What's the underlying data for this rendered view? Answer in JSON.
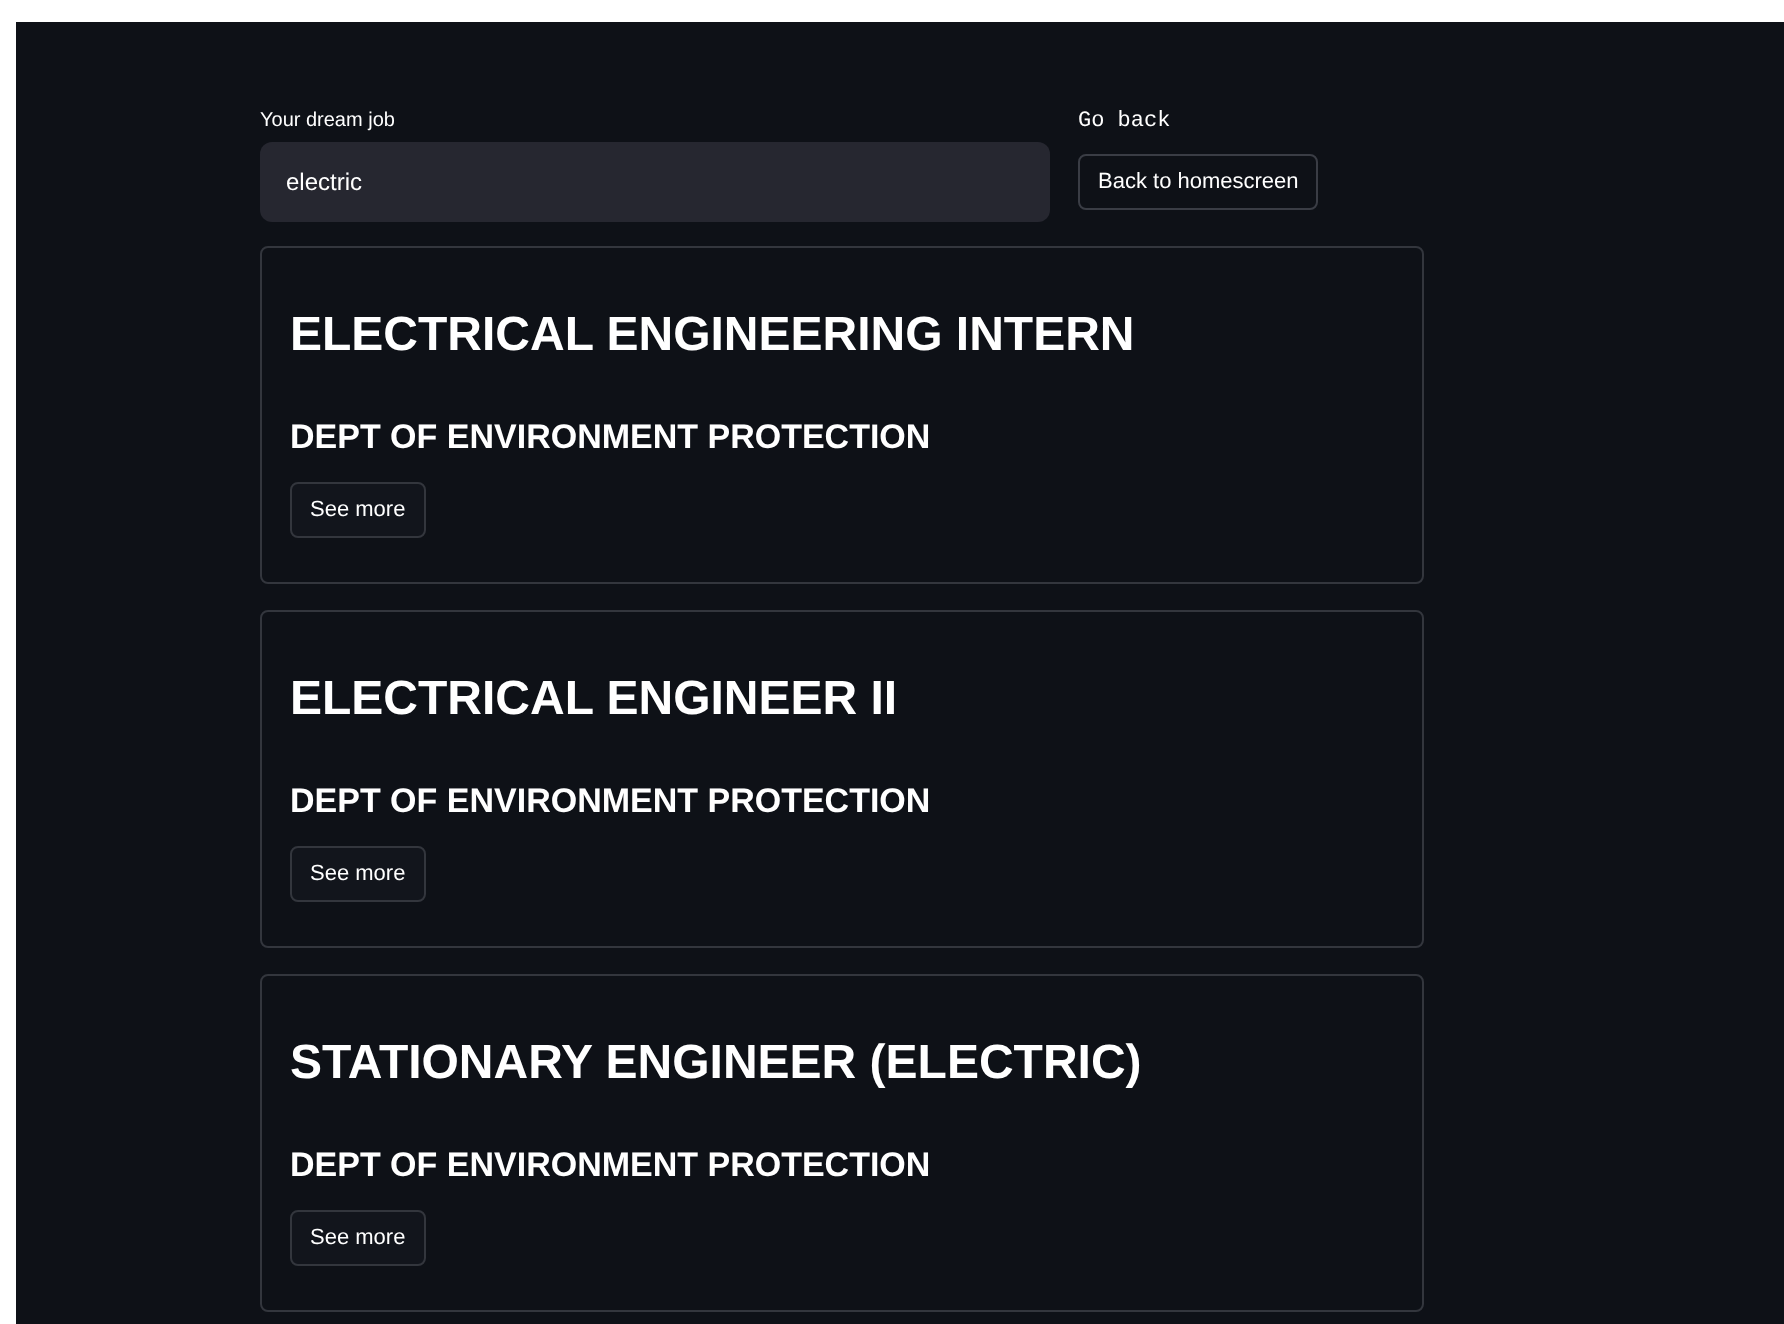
{
  "search": {
    "label": "Your dream job",
    "value": "electric"
  },
  "go_back": {
    "label": "Go back",
    "button": "Back to homescreen"
  },
  "jobs": [
    {
      "title": "ELECTRICAL ENGINEERING INTERN",
      "department": "DEPT OF ENVIRONMENT PROTECTION",
      "button": "See more"
    },
    {
      "title": "ELECTRICAL ENGINEER II",
      "department": "DEPT OF ENVIRONMENT PROTECTION",
      "button": "See more"
    },
    {
      "title": "STATIONARY ENGINEER (ELECTRIC)",
      "department": "DEPT OF ENVIRONMENT PROTECTION",
      "button": "See more"
    }
  ]
}
